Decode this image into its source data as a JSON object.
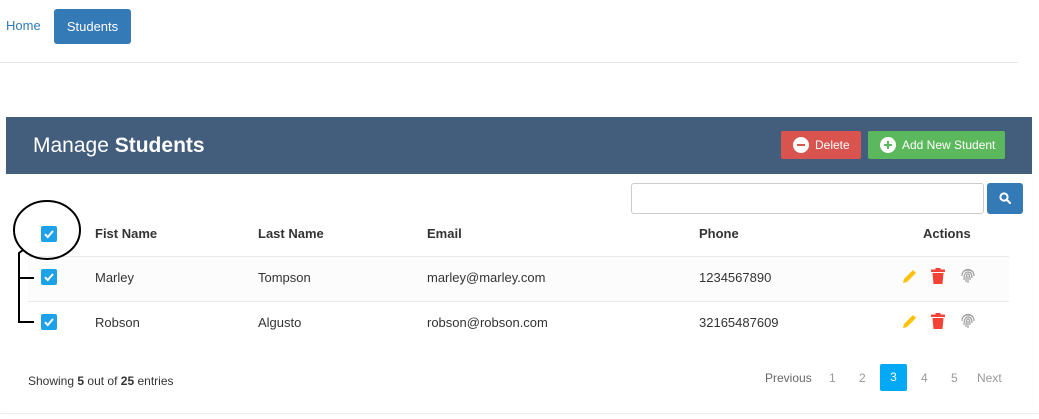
{
  "nav": {
    "home": "Home",
    "students": "Students"
  },
  "panel": {
    "title_light": "Manage",
    "title_bold": "Students",
    "delete_label": "Delete",
    "add_label": "Add New Student"
  },
  "search": {
    "value": "",
    "placeholder": ""
  },
  "table": {
    "headers": {
      "first": "Fist Name",
      "last": "Last Name",
      "email": "Email",
      "phone": "Phone",
      "actions": "Actions"
    },
    "rows": [
      {
        "first": "Marley",
        "last": "Tompson",
        "email": "marley@marley.com",
        "phone": "1234567890"
      },
      {
        "first": "Robson",
        "last": "Algusto",
        "email": "robson@robson.com",
        "phone": "32165487609"
      }
    ]
  },
  "footer": {
    "showing_prefix": "Showing",
    "showing_count": "5",
    "showing_mid": "out of",
    "showing_total": "25",
    "showing_suffix": "entries"
  },
  "pagination": {
    "previous": "Previous",
    "p1": "1",
    "p2": "2",
    "p3": "3",
    "p4": "4",
    "p5": "5",
    "next": "Next"
  },
  "colors": {
    "header": "#435d7d",
    "delete": "#d9534f",
    "add": "#5cb85c",
    "primary": "#337ab7",
    "checkbox": "#1da1e8",
    "edit": "#ffc107",
    "trash": "#f44336",
    "active_page": "#03a9f4"
  },
  "icons": [
    "search-icon",
    "minus-circle-icon",
    "plus-circle-icon",
    "check-icon",
    "pencil-icon",
    "trash-icon",
    "fingerprint-icon"
  ]
}
